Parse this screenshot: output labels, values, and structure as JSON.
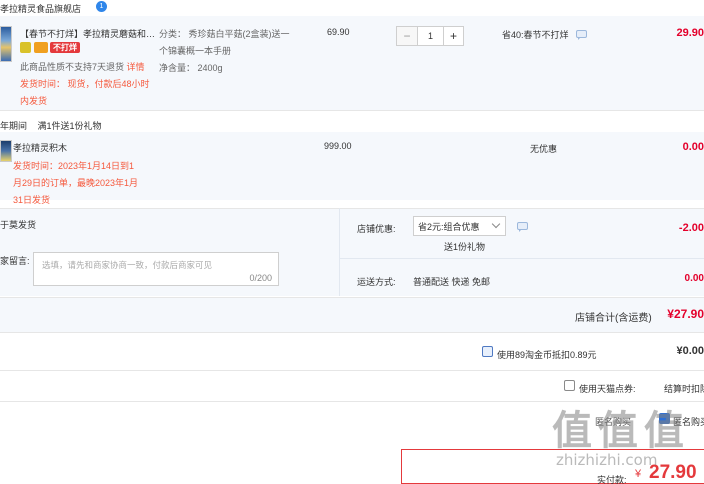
{
  "shop": {
    "name": "孝拉精灵食品旗舰店",
    "count_badge": "1"
  },
  "item1": {
    "title": "【春节不打烊】孝拉精灵蘑菇和…",
    "badge": "不打烊",
    "spec_line1": "分类： 秀珍菇白平菇(2盒装)送一",
    "spec_line2": "个锦囊概一本手册",
    "net_weight": "净含量： 2400g",
    "no_return": "此商品性质不支持7天退货",
    "detail_link": "详情",
    "ship_line1": "发货时间： 现货，付款后48小时",
    "ship_line2": "内发货",
    "price": "69.90",
    "quantity": "1",
    "minus": "−",
    "plus": "+",
    "discount": "省40:春节不打烊",
    "subtotal": "29.90"
  },
  "promo": {
    "label": "年期间",
    "desc": "满1件送1份礼物"
  },
  "item2": {
    "title": "孝拉精灵积木",
    "ship_line1": "发货时间：2023年1月14日到1",
    "ship_line2": "月29日的订单，最晚2023年1月",
    "ship_line3": "31日发货",
    "price": "999.00",
    "discount": "无优惠",
    "subtotal": "0.00"
  },
  "order": {
    "ship_from": "于莫发货",
    "message_label": "家留言:",
    "message_placeholder": "选填，请先和商家协商一致，付款后商家可见",
    "message_counter": "0/200",
    "shop_discount_label": "店铺优惠:",
    "shop_discount_value": "省2元:组合优惠",
    "gift": "送1份礼物",
    "shop_discount_amount": "-2.00",
    "delivery_label": "运送方式:",
    "delivery_value": "普通配送 快递 免邮",
    "delivery_amount": "0.00",
    "shop_total_label": "店铺合计(含运费)",
    "shop_total_amount": "¥27.90"
  },
  "coins": {
    "label": "使用89淘金币抵扣0.89元",
    "amount": "¥0.00"
  },
  "tmall": {
    "label": "使用天猫点券:",
    "note": "结算时扣除"
  },
  "anon": {
    "label": "匿名购买",
    "checkbox_label": "匿名购买"
  },
  "pay": {
    "label": "实付款:",
    "currency": "¥",
    "amount": "27.90"
  },
  "watermark": {
    "cn": "值 值 值",
    "site": "zhizhizhi.com"
  }
}
